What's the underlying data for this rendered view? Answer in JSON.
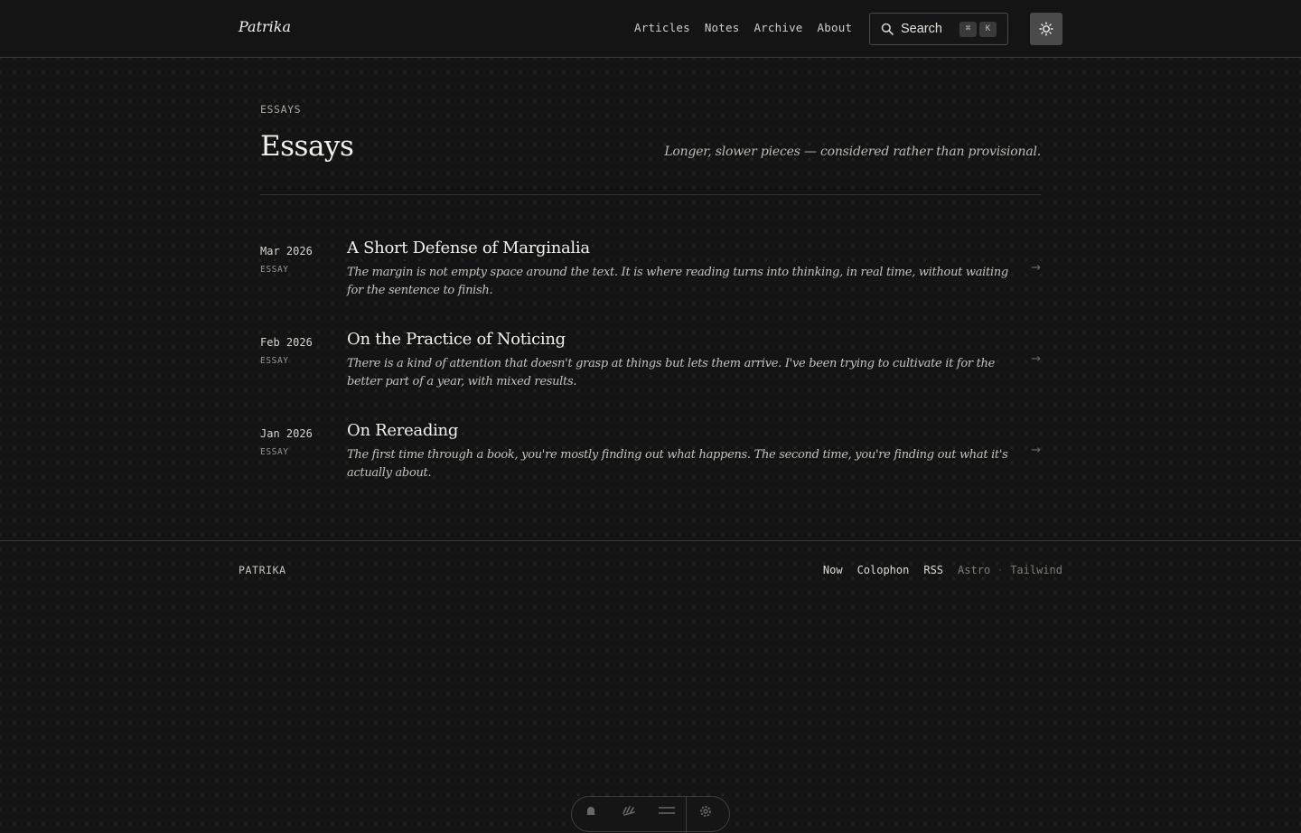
{
  "header": {
    "brand": "Patrika",
    "nav": [
      {
        "label": "Articles"
      },
      {
        "label": "Notes"
      },
      {
        "label": "Archive"
      },
      {
        "label": "About"
      }
    ],
    "search": {
      "label": "Search",
      "shortcut": [
        "⌘",
        "K"
      ],
      "icon": "search-icon"
    },
    "theme_toggle": {
      "icon": "sun-icon"
    }
  },
  "page": {
    "eyebrow": "ESSAYS",
    "title": "Essays",
    "tagline": "Longer, slower pieces — considered rather than provisional."
  },
  "entries": [
    {
      "date": "Mar 2026",
      "type": "ESSAY",
      "title": "A Short Defense of Marginalia",
      "excerpt": "The margin is not empty space around the text. It is where reading turns into thinking, in real time, without waiting for the sentence to finish.",
      "arrow": "→"
    },
    {
      "date": "Feb 2026",
      "type": "ESSAY",
      "title": "On the Practice of Noticing",
      "excerpt": "There is a kind of attention that doesn't grasp at things but lets them arrive. I've been trying to cultivate it for the better part of a year, with mixed results.",
      "arrow": "→"
    },
    {
      "date": "Jan 2026",
      "type": "ESSAY",
      "title": "On Rereading",
      "excerpt": "The first time through a book, you're mostly finding out what happens. The second time, you're finding out what it's actually about.",
      "arrow": "→"
    }
  ],
  "footer": {
    "brand": "PATRIKA",
    "links": [
      {
        "label": "Now"
      },
      {
        "label": "Colophon"
      },
      {
        "label": "RSS"
      }
    ],
    "meta": [
      "Astro",
      "·",
      "Tailwind"
    ]
  },
  "dock": {
    "icons": [
      "bell-icon",
      "hand-icon",
      "menu-icon",
      "gear-icon"
    ]
  },
  "colors": {
    "background": "#141414",
    "text": "#e8e6e1",
    "muted": "#9a9892",
    "border": "#3a3a3a"
  }
}
